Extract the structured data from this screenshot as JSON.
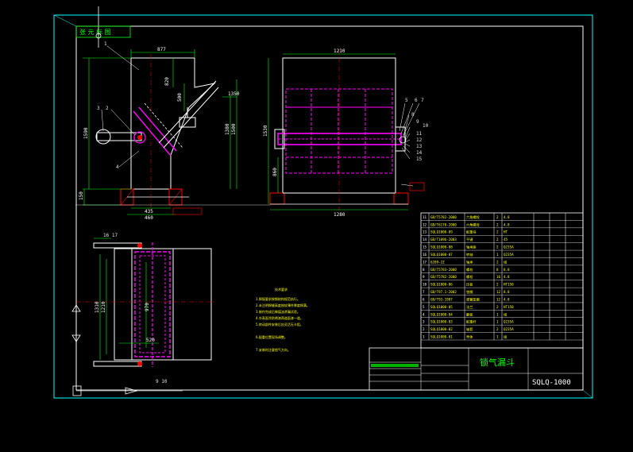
{
  "drawing": {
    "stamp_text": "张 元 标 图",
    "title": "锁气漏斗",
    "code": "SQLQ-1000",
    "colors": {
      "background": "#000000",
      "border": "#00ffff",
      "outline": "#ffffff",
      "hidden": "#ff00ff",
      "annotation": "#00ff00",
      "text": "#ffff00",
      "hatch": "#ff0000"
    }
  },
  "side_view": {
    "dims": {
      "top_width": "877",
      "d820": "820",
      "d500": "500",
      "d1500": "1500",
      "d1350": "1350",
      "d1380": "1380",
      "left_height": "1590",
      "d150": "150",
      "d435": "435",
      "d460": "460"
    },
    "callouts": [
      "1",
      "2",
      "3",
      "4"
    ]
  },
  "front_view": {
    "dims": {
      "top": "1210",
      "bottom": "1280",
      "height": "1530",
      "d860": "860"
    },
    "callouts": [
      "5",
      "6",
      "7",
      "8",
      "9",
      "10",
      "11",
      "12",
      "13",
      "14",
      "15"
    ]
  },
  "plan_view": {
    "dims": {
      "left_outer": "1310",
      "left_inner": "1210",
      "inner": "970",
      "d520": "520"
    },
    "callouts_top": "16 17",
    "callouts_bottom": "9 10"
  },
  "notes": {
    "heading": "技术要求",
    "lines": [
      "1.焊接要求按钢结构规范执行。",
      "2.未注明焊缝高度按较薄件厚度焊满。",
      "3.制作完成后做煤油渗漏试验。",
      "4.外表面涂防锈漆两道面漆一道。",
      "5.转动部件安装后应灵活无卡阻。",
      "6.配重位置现场调整。",
      "7.安装时注意锁气方向。"
    ]
  },
  "parts_table": {
    "rows": [
      [
        "11",
        "GB/T5782-2000",
        "六角螺栓",
        "2",
        "4.8"
      ],
      [
        "12",
        "GB/T6170-2000",
        "六角螺母",
        "2",
        "4.8"
      ],
      [
        "13",
        "SQLQ1000-09",
        "配重块",
        "2",
        "HT"
      ],
      [
        "14",
        "GB/T1096-2003",
        "平键",
        "2",
        "45"
      ],
      [
        "15",
        "SQLQ1000-08",
        "轴承座",
        "2",
        "Q235A"
      ],
      [
        "16",
        "SQLQ1000-07",
        "转轴",
        "1",
        "Q235A"
      ],
      [
        "17",
        "6209-2Z",
        "轴承",
        "2",
        "组"
      ],
      [
        "8",
        "GB/T5783-2000",
        "螺栓",
        "8",
        "8.8"
      ],
      [
        "9",
        "GB/T5782-2000",
        "螺栓",
        "16",
        "4.8"
      ],
      [
        "10",
        "SQLQ1000-06",
        "压板",
        "2",
        "HT150"
      ],
      [
        "7",
        "GB/T97.1-2002",
        "垫圈",
        "12",
        "8.8"
      ],
      [
        "6",
        "GB/T93-1987",
        "弹簧垫圈",
        "12",
        "4.8"
      ],
      [
        "5",
        "SQLQ1000-05",
        "法兰",
        "2",
        "HT150"
      ],
      [
        "4",
        "SQLQ1000-04",
        "翻板",
        "1",
        "组"
      ],
      [
        "3",
        "SQLQ1000-03",
        "配重杆",
        "1",
        "Q235A"
      ],
      [
        "2",
        "SQLQ1000-02",
        "轴套",
        "2",
        "Q235A"
      ],
      [
        "1",
        "SQLQ1000-01",
        "壳体",
        "1",
        "组"
      ]
    ]
  }
}
